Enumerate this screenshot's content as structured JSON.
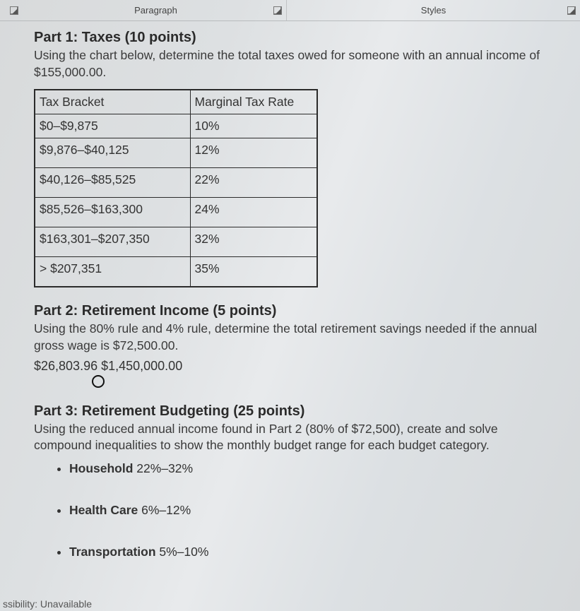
{
  "ribbon": {
    "paragraph_label": "Paragraph",
    "styles_label": "Styles"
  },
  "part1": {
    "heading": "Part 1: Taxes (10 points)",
    "body": "Using the chart below, determine the total taxes owed for someone with an annual income of $155,000.00.",
    "table": {
      "headers": [
        "Tax Bracket",
        "Marginal Tax Rate"
      ],
      "rows": [
        [
          "$0–$9,875",
          "10%"
        ],
        [
          "$9,876–$40,125",
          "12%"
        ],
        [
          "$40,126–$85,525",
          "22%"
        ],
        [
          "$85,526–$163,300",
          "24%"
        ],
        [
          "$163,301–$207,350",
          "32%"
        ],
        [
          "> $207,351",
          "35%"
        ]
      ]
    }
  },
  "part2": {
    "heading": "Part 2: Retirement Income (5 points)",
    "body": "Using the 80% rule and 4% rule, determine the total retirement savings needed if the annual gross wage is $72,500.00.",
    "answers": "$26,803.96 $1,450,000.00"
  },
  "part3": {
    "heading": "Part 3: Retirement Budgeting (25 points)",
    "body": "Using the reduced annual income found in Part 2 (80% of $72,500), create and solve compound inequalities to show the monthly budget range for each budget category.",
    "categories": [
      {
        "name": "Household",
        "range": "22%–32%"
      },
      {
        "name": "Health Care",
        "range": "6%–12%"
      },
      {
        "name": "Transportation",
        "range": "5%–10%"
      }
    ]
  },
  "statusbar": "ssibility: Unavailable"
}
